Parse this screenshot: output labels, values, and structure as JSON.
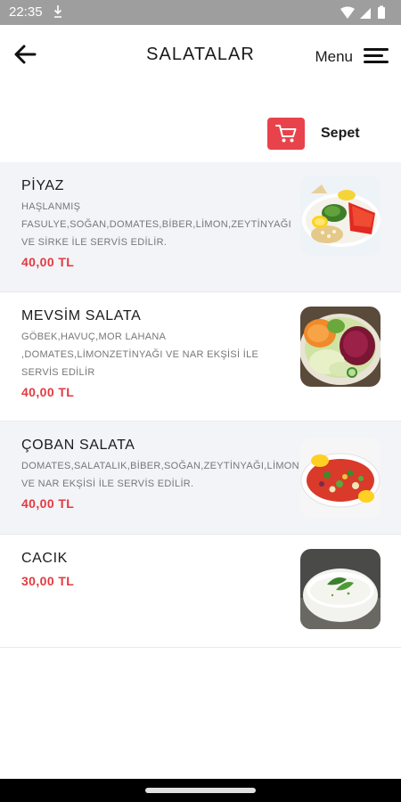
{
  "status_bar": {
    "time": "22:35",
    "notification_icon": "download-icon"
  },
  "header": {
    "title": "SALATALAR",
    "back_icon": "arrow-left-icon",
    "menu_label": "Menu",
    "menu_icon": "hamburger-icon"
  },
  "cart": {
    "label": "Sepet",
    "icon": "cart-icon",
    "color": "#e8434b"
  },
  "accent": {
    "price_color": "#e23a3f"
  },
  "items": [
    {
      "name": "PİYAZ",
      "description": "HAŞLANMIŞ FASULYE,SOĞAN,DOMATES,BİBER,LİMON,ZEYTİNYAĞI VE SİRKE İLE SERVİS EDİLİR.",
      "price": "40,00 TL",
      "image": "piyaz-photo"
    },
    {
      "name": "MEVSİM SALATA",
      "description": "GÖBEK,HAVUÇ,MOR LAHANA ,DOMATES,LİMONZETİNYAĞI VE NAR EKŞİSİ İLE SERVİS EDİLİR",
      "price": "40,00 TL",
      "image": "mevsim-salata-photo"
    },
    {
      "name": "ÇOBAN SALATA",
      "description": "DOMATES,SALATALIK,BİBER,SOĞAN,ZEYTİNYAĞI,LİMON VE NAR EKŞİSİ İLE SERVİS EDİLİR.",
      "price": "40,00 TL",
      "image": "coban-salata-photo"
    },
    {
      "name": "CACIK",
      "description": "",
      "price": "30,00 TL",
      "image": "cacik-photo"
    }
  ]
}
